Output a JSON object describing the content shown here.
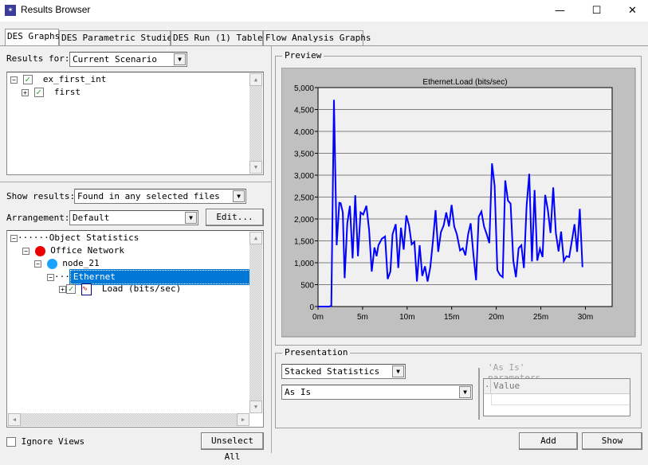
{
  "window": {
    "title": "Results Browser",
    "icon": "app-star-icon",
    "minimize": "—",
    "maximize": "☐",
    "close": "✕"
  },
  "tabs": [
    {
      "label": "DES Graphs",
      "active": true
    },
    {
      "label": "DES Parametric Studies"
    },
    {
      "label": "DES Run (1) Tables"
    },
    {
      "label": "Flow Analysis Graphs"
    }
  ],
  "results_for": {
    "label": "Results for:",
    "value": "Current Scenario"
  },
  "files_tree": [
    {
      "label": "ex_first_int",
      "expander": "−",
      "checked": true
    },
    {
      "label": "first",
      "expander": "+",
      "checked": true
    }
  ],
  "show_results": {
    "label": "Show results:",
    "value": "Found in any selected files"
  },
  "arrangement": {
    "label": "Arrangement:",
    "value": "Default",
    "edit": "Edit..."
  },
  "stats_tree": {
    "root": "Object Statistics",
    "network": "Office Network",
    "node": "node_21",
    "selected": "Ethernet",
    "stat": "Load (bits/sec)"
  },
  "ignore_views": {
    "label": "Ignore Views",
    "checked": false
  },
  "unselect_all": "Unselect All",
  "preview": {
    "label": "Preview"
  },
  "presentation": {
    "label": "Presentation",
    "mode": "Stacked Statistics",
    "filter": "As Is",
    "params_label": "'As Is' parameters",
    "params_col_dot": ".",
    "params_col": "Value"
  },
  "buttons": {
    "add": "Add",
    "show": "Show"
  },
  "colors": {
    "line": "#0000ff",
    "selection": "#0078d7",
    "plot_bg": "#f0f0f0",
    "panel_bg": "#c0c0c0"
  },
  "chart_data": {
    "type": "line",
    "title": "Ethernet.Load (bits/sec)",
    "xlabel": "",
    "ylabel": "",
    "xlim": [
      0,
      33
    ],
    "ylim": [
      0,
      5000
    ],
    "grid": true,
    "xticks": [
      "0m",
      "5m",
      "10m",
      "15m",
      "20m",
      "25m",
      "30m"
    ],
    "yticks": [
      "0",
      "500",
      "1,000",
      "1,500",
      "2,000",
      "2,500",
      "3,000",
      "3,500",
      "4,000",
      "4,500",
      "5,000"
    ],
    "x_unit": "minutes",
    "x": [
      0,
      1.25,
      1.49,
      1.79,
      2.09,
      2.39,
      2.54,
      2.78,
      2.99,
      3.28,
      3.58,
      3.88,
      4.18,
      4.48,
      4.78,
      5.07,
      5.43,
      5.73,
      6.03,
      6.33,
      6.57,
      6.78,
      7.16,
      7.52,
      7.82,
      8.12,
      8.36,
      8.72,
      9.01,
      9.31,
      9.61,
      9.91,
      10.21,
      10.51,
      10.81,
      11.1,
      11.4,
      11.7,
      12.0,
      12.3,
      12.6,
      12.9,
      13.19,
      13.49,
      13.79,
      14.09,
      14.39,
      14.69,
      14.99,
      15.28,
      15.58,
      15.94,
      16.24,
      16.54,
      16.84,
      17.13,
      17.43,
      17.73,
      18.03,
      18.33,
      18.63,
      18.93,
      19.22,
      19.52,
      19.82,
      20.12,
      20.42,
      20.72,
      21.01,
      21.31,
      21.61,
      21.91,
      22.21,
      22.51,
      22.81,
      23.1,
      23.4,
      23.7,
      24.0,
      24.3,
      24.6,
      24.9,
      25.19,
      25.49,
      25.79,
      26.09,
      26.39,
      26.69,
      26.99,
      27.28,
      27.58,
      27.88,
      28.18,
      28.48,
      28.78,
      29.07,
      29.37,
      29.67
    ],
    "y": [
      0,
      0,
      20,
      4720,
      1400,
      2370,
      2360,
      2150,
      650,
      1900,
      2300,
      1100,
      2540,
      1150,
      2150,
      2100,
      2300,
      1750,
      800,
      1350,
      1150,
      1400,
      1550,
      1600,
      630,
      800,
      1650,
      1880,
      880,
      1800,
      1300,
      2080,
      1850,
      1420,
      1480,
      570,
      1400,
      700,
      920,
      570,
      900,
      1500,
      2200,
      1250,
      1700,
      1850,
      2150,
      1830,
      2320,
      1830,
      1650,
      1280,
      1330,
      1170,
      1650,
      1900,
      1200,
      600,
      2050,
      2170,
      1830,
      1650,
      1450,
      3270,
      2750,
      830,
      720,
      670,
      2880,
      2420,
      2350,
      1050,
      670,
      1330,
      1400,
      880,
      2300,
      3030,
      1030,
      2660,
      1050,
      1320,
      1130,
      2550,
      2200,
      1680,
      2720,
      1680,
      1260,
      1710,
      1040,
      1150,
      1130,
      1500,
      1880,
      1250,
      2230,
      900
    ]
  }
}
